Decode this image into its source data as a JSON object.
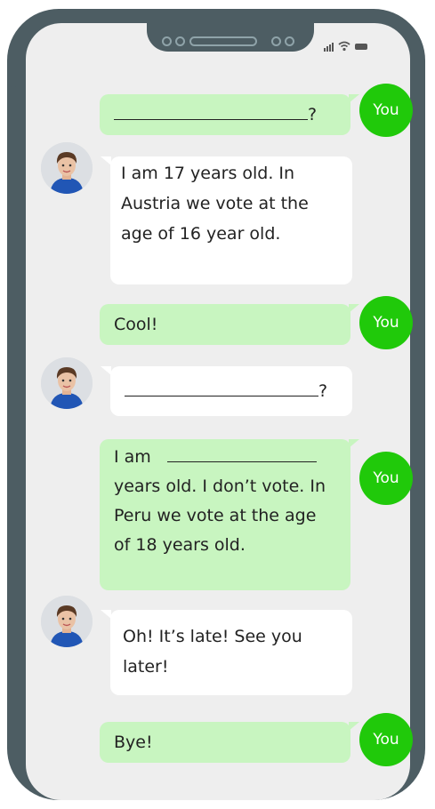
{
  "colors": {
    "frame": "#4d5d63",
    "screen_bg": "#eeeeee",
    "sent_bubble": "#c8f5c0",
    "received_bubble": "#ffffff",
    "you_avatar": "#20c90a"
  },
  "status_bar": {
    "icons": [
      "signal-icon",
      "wifi-icon",
      "battery-icon"
    ]
  },
  "you_label": "You",
  "messages": [
    {
      "sender": "you",
      "text": "",
      "blank": true,
      "end": "?"
    },
    {
      "sender": "friend",
      "text": "I am 17 years old. In Austria we vote at the age of 16 year old."
    },
    {
      "sender": "you",
      "text": "Cool!"
    },
    {
      "sender": "friend",
      "text": "",
      "blank": true,
      "end": "?"
    },
    {
      "sender": "you",
      "start": "I am",
      "blank": true,
      "text": "years old. I don’t vote. In Peru we vote at the age of 18 years old."
    },
    {
      "sender": "friend",
      "text": "Oh! It’s late! See you later!"
    },
    {
      "sender": "you",
      "text": "Bye!"
    }
  ]
}
